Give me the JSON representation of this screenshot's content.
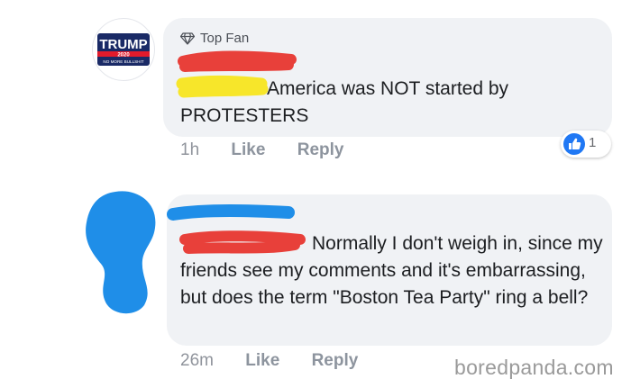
{
  "comment_top": {
    "avatar": {
      "text": "TRUMP 2020 NO MORE BULLSHIT",
      "colors": [
        "#1a2a66",
        "#e21b2c",
        "#ffffff"
      ]
    },
    "badge": {
      "icon": "diamond-icon",
      "label": "Top Fan"
    },
    "text": "America was NOT started by PROTESTERS",
    "time": "1h",
    "like_label": "Like",
    "reply_label": "Reply",
    "reactions": {
      "icon": "thumbs-up-icon",
      "count": "1",
      "color": "#2078f4"
    }
  },
  "comment_reply": {
    "text": "Normally I don't weigh in, since my friends see my comments and it's embarrassing,  but does the term \"Boston Tea Party\" ring a bell?",
    "time": "26m",
    "like_label": "Like",
    "reply_label": "Reply"
  },
  "redactions": {
    "red": "#e8403a",
    "yellow": "#f7e62a",
    "blue": "#1f8ee8"
  },
  "watermark": "boredpanda.com"
}
